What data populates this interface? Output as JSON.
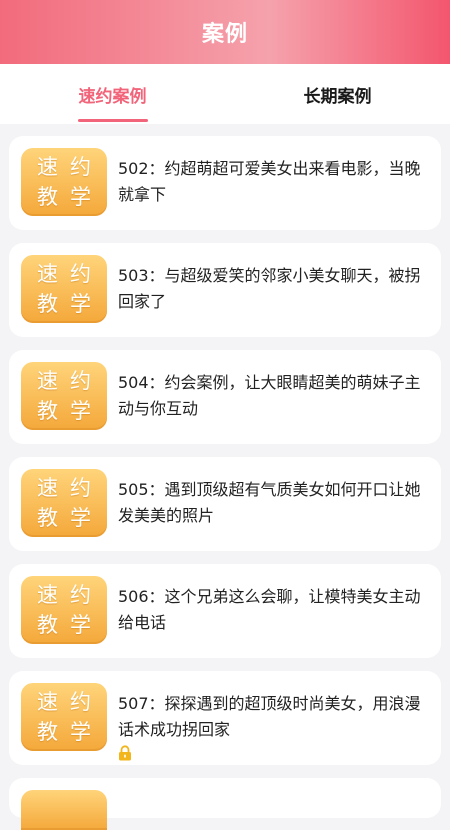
{
  "header": {
    "title": "案例"
  },
  "tabs": [
    {
      "label": "速约案例",
      "active": true
    },
    {
      "label": "长期案例",
      "active": false
    }
  ],
  "badge": {
    "line1": "速约",
    "line2": "教学"
  },
  "cases": [
    {
      "text": "502：约超萌超可爱美女出来看电影，当晚就拿下",
      "locked": false
    },
    {
      "text": "503：与超级爱笑的邻家小美女聊天，被拐回家了",
      "locked": false
    },
    {
      "text": "504：约会案例，让大眼睛超美的萌妹子主动与你互动",
      "locked": false
    },
    {
      "text": "505：遇到顶级超有气质美女如何开口让她发美美的照片",
      "locked": false
    },
    {
      "text": "506：这个兄弟这么会聊，让模特美女主动给电话",
      "locked": false
    },
    {
      "text": "507：探探遇到的超顶级时尚美女，用浪漫话术成功拐回家",
      "locked": true
    }
  ],
  "colors": {
    "accent": "#f2647a",
    "badge_top": "#ffd47a",
    "badge_bottom": "#f4a83a",
    "lock": "#f2b51c"
  }
}
